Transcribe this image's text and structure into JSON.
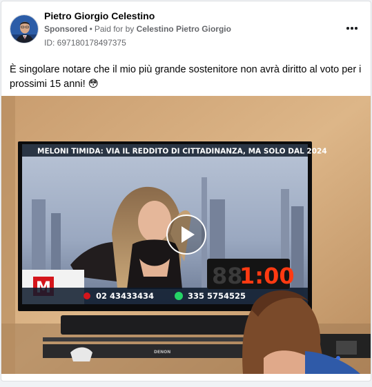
{
  "post": {
    "author_name": "Pietro Giorgio Celestino",
    "sponsored_label": "Sponsored",
    "paid_for_prefix": "Paid for by",
    "payer_name": "Celestino Pietro Giorgio",
    "ad_id": "ID: 697180178497375",
    "body_text": "È singolare notare che il mio più grande sostenitore non avrà diritto al voto per i prossimi 15 anni! 😳",
    "icons": {
      "more": "more-options-icon",
      "play": "play-icon"
    }
  },
  "video": {
    "tv_headline": "MELONI TIMIDA: VIA IL REDDITO DI CITTADINANZA, MA SOLO DAL 2024",
    "channel_logo_letter": "M",
    "phone_number": "02 43433434",
    "whatsapp_number": "335 5754525",
    "clock_digits": "1:00",
    "soundbar_brand": "DENON"
  },
  "colors": {
    "link_gray": "#65676b",
    "text_dark": "#050505",
    "wall": "#d9b183",
    "tv_ticker": "#2a3544",
    "clock_red": "#ff3a12",
    "logo_red": "#d4151b"
  }
}
